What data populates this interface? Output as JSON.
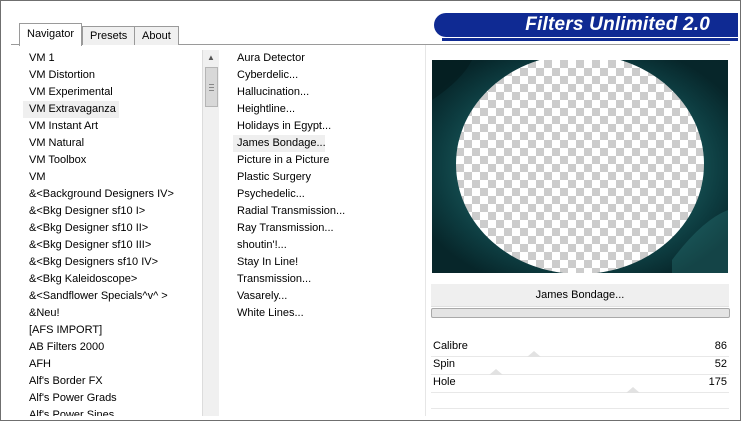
{
  "tabs": [
    {
      "label": "Navigator",
      "active": true
    },
    {
      "label": "Presets",
      "active": false
    },
    {
      "label": "About",
      "active": false
    }
  ],
  "title": "Filters Unlimited 2.0",
  "categories": [
    "VM 1",
    "VM Distortion",
    "VM Experimental",
    "VM Extravaganza",
    "VM Instant Art",
    "VM Natural",
    "VM Toolbox",
    "VM",
    "&<Background Designers IV>",
    "&<Bkg Designer sf10 I>",
    "&<Bkg Designer sf10 II>",
    "&<Bkg Designer sf10 III>",
    "&<Bkg Designers sf10 IV>",
    "&<Bkg Kaleidoscope>",
    "&<Sandflower Specials^v^ >",
    "&Neu!",
    "[AFS IMPORT]",
    "AB Filters 2000",
    "AFH",
    "Alf's Border FX",
    "Alf's Power Grads",
    "Alf's Power Sines"
  ],
  "selected_category": "VM Extravaganza",
  "filters": [
    "Aura Detector",
    "Cyberdelic...",
    "Hallucination...",
    "Heightline...",
    "Holidays in Egypt...",
    "James Bondage...",
    "Picture in a Picture",
    "Plastic Surgery",
    "Psychedelic...",
    "Radial Transmission...",
    "Ray Transmission...",
    "shoutin'!...",
    "Stay In Line!",
    "Transmission...",
    "Vasarely...",
    "White Lines..."
  ],
  "selected_filter": "James Bondage...",
  "preview_filter_name": "James Bondage...",
  "params": [
    {
      "label": "Calibre",
      "value": "86",
      "level": 0.337
    },
    {
      "label": "Spin",
      "value": "52",
      "level": 0.204
    },
    {
      "label": "Hole",
      "value": "175",
      "level": 0.686
    }
  ],
  "colors": {
    "banner": "#0f2a93",
    "preview_bg": "#0b2f33"
  }
}
